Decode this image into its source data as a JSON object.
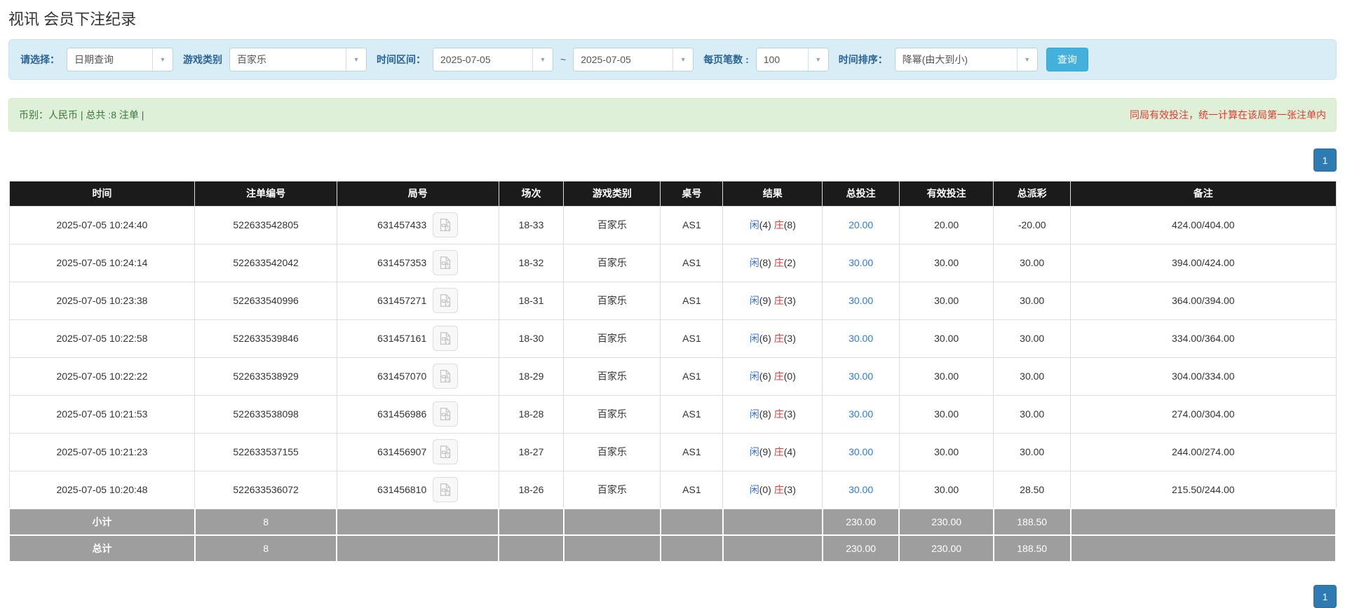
{
  "page_title": "视讯 会员下注纪录",
  "filters": {
    "select_label": "请选择：",
    "select_value": "日期查询",
    "game_type_label": "游戏类别",
    "game_type_value": "百家乐",
    "time_range_label": "时间区间：",
    "date_from": "2025-07-05",
    "tilde": "~",
    "date_to": "2025-07-05",
    "page_size_label": "每页笔数 :",
    "page_size_value": "100",
    "sort_label": "时间排序：",
    "sort_value": "降幂(由大到小)",
    "search_button_label": "查询"
  },
  "summary": {
    "left_text": "币别：人民币 | 总共 :8 注单 |",
    "right_notice": "同局有效投注，统一计算在该局第一张注单内"
  },
  "pagination": {
    "current_page": "1"
  },
  "table": {
    "headers": [
      "时间",
      "注单编号",
      "局号",
      "场次",
      "游戏类别",
      "桌号",
      "结果",
      "总投注",
      "有效投注",
      "总派彩",
      "备注"
    ],
    "rows": [
      {
        "time": "2025-07-05 10:24:40",
        "bet_number": "522633542805",
        "round_number": "631457433",
        "session": "18-33",
        "game_type": "百家乐",
        "table_number": "AS1",
        "result": {
          "player": "闲",
          "player_score": "(4)",
          "banker": "庄",
          "banker_score": "(8)"
        },
        "total_bet": "20.00",
        "valid_bet": "20.00",
        "payout": "-20.00",
        "remark": "424.00/404.00"
      },
      {
        "time": "2025-07-05 10:24:14",
        "bet_number": "522633542042",
        "round_number": "631457353",
        "session": "18-32",
        "game_type": "百家乐",
        "table_number": "AS1",
        "result": {
          "player": "闲",
          "player_score": "(8)",
          "banker": "庄",
          "banker_score": "(2)"
        },
        "total_bet": "30.00",
        "valid_bet": "30.00",
        "payout": "30.00",
        "remark": "394.00/424.00"
      },
      {
        "time": "2025-07-05 10:23:38",
        "bet_number": "522633540996",
        "round_number": "631457271",
        "session": "18-31",
        "game_type": "百家乐",
        "table_number": "AS1",
        "result": {
          "player": "闲",
          "player_score": "(9)",
          "banker": "庄",
          "banker_score": "(3)"
        },
        "total_bet": "30.00",
        "valid_bet": "30.00",
        "payout": "30.00",
        "remark": "364.00/394.00"
      },
      {
        "time": "2025-07-05 10:22:58",
        "bet_number": "522633539846",
        "round_number": "631457161",
        "session": "18-30",
        "game_type": "百家乐",
        "table_number": "AS1",
        "result": {
          "player": "闲",
          "player_score": "(6)",
          "banker": "庄",
          "banker_score": "(3)"
        },
        "total_bet": "30.00",
        "valid_bet": "30.00",
        "payout": "30.00",
        "remark": "334.00/364.00"
      },
      {
        "time": "2025-07-05 10:22:22",
        "bet_number": "522633538929",
        "round_number": "631457070",
        "session": "18-29",
        "game_type": "百家乐",
        "table_number": "AS1",
        "result": {
          "player": "闲",
          "player_score": "(6)",
          "banker": "庄",
          "banker_score": "(0)"
        },
        "total_bet": "30.00",
        "valid_bet": "30.00",
        "payout": "30.00",
        "remark": "304.00/334.00"
      },
      {
        "time": "2025-07-05 10:21:53",
        "bet_number": "522633538098",
        "round_number": "631456986",
        "session": "18-28",
        "game_type": "百家乐",
        "table_number": "AS1",
        "result": {
          "player": "闲",
          "player_score": "(8)",
          "banker": "庄",
          "banker_score": "(3)"
        },
        "total_bet": "30.00",
        "valid_bet": "30.00",
        "payout": "30.00",
        "remark": "274.00/304.00"
      },
      {
        "time": "2025-07-05 10:21:23",
        "bet_number": "522633537155",
        "round_number": "631456907",
        "session": "18-27",
        "game_type": "百家乐",
        "table_number": "AS1",
        "result": {
          "player": "闲",
          "player_score": "(9)",
          "banker": "庄",
          "banker_score": "(4)"
        },
        "total_bet": "30.00",
        "valid_bet": "30.00",
        "payout": "30.00",
        "remark": "244.00/274.00"
      },
      {
        "time": "2025-07-05 10:20:48",
        "bet_number": "522633536072",
        "round_number": "631456810",
        "session": "18-26",
        "game_type": "百家乐",
        "table_number": "AS1",
        "result": {
          "player": "闲",
          "player_score": "(0)",
          "banker": "庄",
          "banker_score": "(3)"
        },
        "total_bet": "30.00",
        "valid_bet": "30.00",
        "payout": "28.50",
        "remark": "215.50/244.00"
      }
    ],
    "subtotal": {
      "label": "小计",
      "count": "8",
      "total_bet": "230.00",
      "valid_bet": "230.00",
      "payout": "188.50"
    },
    "total": {
      "label": "总计",
      "count": "8",
      "total_bet": "230.00",
      "valid_bet": "230.00",
      "payout": "188.50"
    }
  },
  "icons": {
    "video_replay": "video-file-icon",
    "dropdown_arrow": "chevron-down-icon"
  },
  "colors": {
    "filter_bar_bg": "#d9edf7",
    "filter_label": "#2a6496",
    "search_button_bg": "#43b1dc",
    "summary_bg": "#dff0d8",
    "summary_text": "#3c763d",
    "notice_red": "#e03c31",
    "header_bg": "#1b1b1b",
    "link_blue": "#2e7bd9",
    "player_blue": "#3a6fd8",
    "banker_red": "#dd3b38",
    "negative_red": "#f00000",
    "totals_bg": "#9e9e9e",
    "pagination_blue": "#2e7bb4"
  }
}
